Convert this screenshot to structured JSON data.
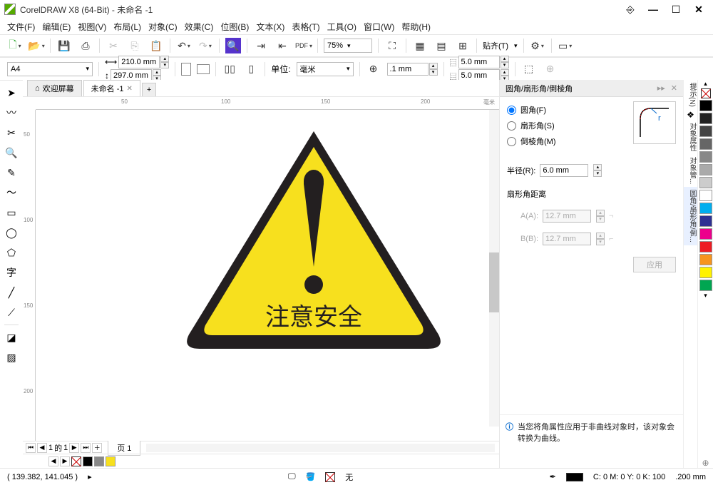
{
  "title": "CorelDRAW X8 (64-Bit) - 未命名 -1",
  "menu": [
    "文件(F)",
    "编辑(E)",
    "视图(V)",
    "布局(L)",
    "对象(C)",
    "效果(C)",
    "位图(B)",
    "文本(X)",
    "表格(T)",
    "工具(O)",
    "窗口(W)",
    "帮助(H)"
  ],
  "toolbar1": {
    "zoom": "75%",
    "snap": "贴齐(T)"
  },
  "toolbar2": {
    "page_size": "A4",
    "width": "210.0 mm",
    "height": "297.0 mm",
    "unit_label": "单位:",
    "unit_value": "毫米",
    "nudge": ".1 mm",
    "dupx": "5.0 mm",
    "dupy": "5.0 mm"
  },
  "tabs": {
    "welcome": "欢迎屏幕",
    "doc": "未命名 -1",
    "add": "+"
  },
  "ruler_h": [
    "50",
    "100",
    "150",
    "..."
  ],
  "ruler_v": [
    "50",
    "100",
    "150",
    "200"
  ],
  "sign_text": "注意安全",
  "page_nav": {
    "cur": "1",
    "of": "的",
    "total": "1",
    "page_tab": "页 1"
  },
  "docker": {
    "title": "圆角/扇形角/倒棱角",
    "r1": "圆角(F)",
    "r2": "扇形角(S)",
    "r3": "倒棱角(M)",
    "radius_label": "半径(R):",
    "radius": "6.0 mm",
    "scallop_label": "扇形角距离",
    "a_label": "A(A):",
    "a_val": "12.7 mm",
    "b_label": "B(B):",
    "b_val": "12.7 mm",
    "apply": "应用",
    "hint": "当您将角属性应用于非曲线对象时，该对象会转换为曲线。",
    "side_tabs": [
      "提示(N)",
      "对象属性",
      "对象管...",
      "圆角/扇形角/倒..."
    ]
  },
  "palette": [
    "#ffffff",
    "#000000",
    "#222222",
    "#444444",
    "#666666",
    "#888888",
    "#aaaaaa",
    "#cccccc",
    "#00aeef",
    "#ec008c",
    "#fff200",
    "#ed1c24",
    "#00a651",
    "#2e3192",
    "#f7941d"
  ],
  "bottom_palette": [
    "#000000",
    "#888888",
    "#f7e01e"
  ],
  "status": {
    "coords": "( 139.382, 141.045 )",
    "none": "无",
    "cmyk": "C: 0 M: 0 Y: 0 K: 100",
    "outline": ".200 mm"
  }
}
